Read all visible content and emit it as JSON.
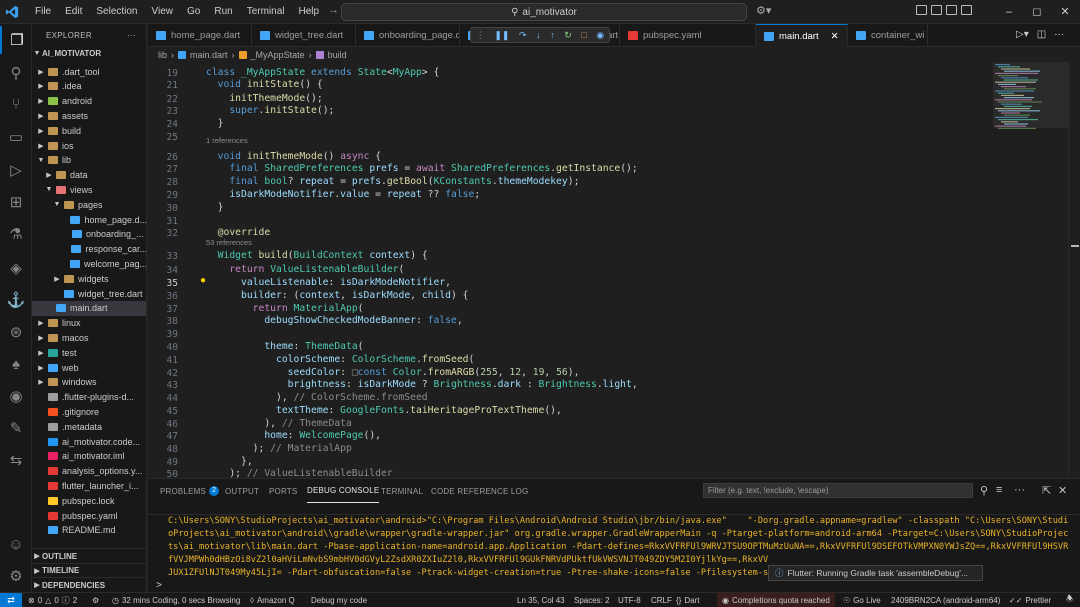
{
  "titlebar": {
    "menu": [
      "File",
      "Edit",
      "Selection",
      "View",
      "Go",
      "Run",
      "Terminal",
      "Help"
    ],
    "search_text": "ai_motivator",
    "window_controls": [
      "–",
      "◻",
      "✕"
    ]
  },
  "activity_bar": {
    "icons": [
      "explorer-icon",
      "search-icon",
      "source-control-icon",
      "remote-explorer-icon",
      "run-debug-icon",
      "extensions-icon",
      "testing-icon",
      "flutter-icon",
      "docker-icon",
      "gitlens-icon",
      "mongodb-icon",
      "github-icon",
      "edit-icon",
      "live-share-icon",
      "accounts-icon",
      "settings-icon"
    ]
  },
  "explorer": {
    "title": "EXPLORER",
    "more": "···",
    "root": "AI_MOTIVATOR",
    "items": [
      {
        "label": ".dart_tool",
        "type": "folder",
        "depth": 1,
        "open": false
      },
      {
        "label": ".idea",
        "type": "folder",
        "depth": 1,
        "open": false
      },
      {
        "label": "android",
        "type": "folder-android",
        "depth": 1,
        "open": false
      },
      {
        "label": "assets",
        "type": "folder",
        "depth": 1,
        "open": false
      },
      {
        "label": "build",
        "type": "folder",
        "depth": 1,
        "open": false
      },
      {
        "label": "ios",
        "type": "folder",
        "depth": 1,
        "open": false
      },
      {
        "label": "lib",
        "type": "folder",
        "depth": 1,
        "open": true
      },
      {
        "label": "data",
        "type": "folder",
        "depth": 2,
        "open": false
      },
      {
        "label": "views",
        "type": "folder-views",
        "depth": 2,
        "open": true
      },
      {
        "label": "pages",
        "type": "folder",
        "depth": 3,
        "open": true
      },
      {
        "label": "home_page.d...",
        "type": "dart",
        "depth": 4
      },
      {
        "label": "onboarding_...",
        "type": "dart",
        "depth": 4
      },
      {
        "label": "response_car...",
        "type": "dart",
        "depth": 4
      },
      {
        "label": "welcome_pag...",
        "type": "dart",
        "depth": 4
      },
      {
        "label": "widgets",
        "type": "folder",
        "depth": 3,
        "open": false
      },
      {
        "label": "widget_tree.dart",
        "type": "dart",
        "depth": 3
      },
      {
        "label": "main.dart",
        "type": "dart",
        "depth": 2,
        "selected": true
      },
      {
        "label": "linux",
        "type": "folder",
        "depth": 1,
        "open": false
      },
      {
        "label": "macos",
        "type": "folder",
        "depth": 1,
        "open": false
      },
      {
        "label": "test",
        "type": "folder-test",
        "depth": 1,
        "open": false
      },
      {
        "label": "web",
        "type": "folder-web",
        "depth": 1,
        "open": false
      },
      {
        "label": "windows",
        "type": "folder",
        "depth": 1,
        "open": false
      },
      {
        "label": ".flutter-plugins-d...",
        "type": "file",
        "depth": 1
      },
      {
        "label": ".gitignore",
        "type": "git",
        "depth": 1
      },
      {
        "label": ".metadata",
        "type": "file",
        "depth": 1
      },
      {
        "label": "ai_motivator.code...",
        "type": "vscode",
        "depth": 1
      },
      {
        "label": "ai_motivator.iml",
        "type": "iml",
        "depth": 1
      },
      {
        "label": "analysis_options.y...",
        "type": "yaml",
        "depth": 1
      },
      {
        "label": "flutter_launcher_i...",
        "type": "yaml",
        "depth": 1
      },
      {
        "label": "pubspec.lock",
        "type": "lock",
        "depth": 1
      },
      {
        "label": "pubspec.yaml",
        "type": "yaml",
        "depth": 1
      },
      {
        "label": "README.md",
        "type": "md",
        "depth": 1
      }
    ],
    "sections": [
      "OUTLINE",
      "TIMELINE",
      "DEPENDENCIES"
    ]
  },
  "tabs": [
    {
      "label": "home_page.dart",
      "active": false
    },
    {
      "label": "widget_tree.dart",
      "active": false
    },
    {
      "label": "onboarding_page.dart",
      "active": false
    },
    {
      "label": "navbar_actionmode_widget.dart",
      "active": false
    },
    {
      "label": "pubspec.yaml",
      "active": false
    },
    {
      "label": "main.dart",
      "active": true
    },
    {
      "label": "container_wi",
      "active": false
    }
  ],
  "breadcrumb": [
    "lib",
    "main.dart",
    "_MyAppState",
    "build"
  ],
  "code_lines": [
    {
      "n": "19",
      "html": "<span class='k'>class</span> <span class='t'>_MyAppState</span> <span class='k'>extends</span> <span class='t'>State</span>&lt;<span class='t'>MyApp</span>&gt; {"
    },
    {
      "n": "21",
      "html": "  <span class='k'>void</span> <span class='f'>initState</span>() {"
    },
    {
      "n": "22",
      "html": "    <span class='f'>initThemeMode</span>();"
    },
    {
      "n": "23",
      "html": "    <span class='k'>super</span>.<span class='f'>initState</span>();"
    },
    {
      "n": "24",
      "html": "  }"
    },
    {
      "n": "25",
      "html": ""
    },
    {
      "n": "26",
      "html": "  <span class='k'>void</span> <span class='f'>initThemeMode</span>() <span class='kc'>async</span> {"
    },
    {
      "n": "27",
      "html": "    <span class='k'>final</span> <span class='t'>SharedPreferences</span> <span class='v'>prefs</span> = <span class='kc'>await</span> <span class='t'>SharedPreferences</span>.<span class='f'>getInstance</span>();"
    },
    {
      "n": "28",
      "html": "    <span class='k'>final</span> <span class='t'>bool</span>? <span class='v'>repeat</span> = <span class='v'>prefs</span>.<span class='f'>getBool</span>(<span class='t'>KConstants</span>.<span class='v'>themeModekey</span>);"
    },
    {
      "n": "29",
      "html": "    <span class='v'>isDarkModeNotifier</span>.<span class='v'>value</span> = <span class='v'>repeat</span> ?? <span class='k'>false</span>;"
    },
    {
      "n": "30",
      "html": "  }"
    },
    {
      "n": "31",
      "html": ""
    },
    {
      "n": "32",
      "html": "  <span class='f'>@override</span>"
    },
    {
      "n": "33",
      "html": "  <span class='t'>Widget</span> <span class='f'>build</span>(<span class='t'>BuildContext</span> <span class='v'>context</span>) {"
    },
    {
      "n": "34",
      "html": "    <span class='kc'>return</span> <span class='t'>ValueListenableBuilder</span>("
    },
    {
      "n": "35",
      "html": "      <span class='v'>valueListenable</span>: <span class='v'>isDarkModeNotifier</span>,"
    },
    {
      "n": "36",
      "html": "      <span class='v'>builder</span>: (<span class='v'>context</span>, <span class='v'>isDarkMode</span>, <span class='v'>child</span>) {"
    },
    {
      "n": "37",
      "html": "        <span class='kc'>return</span> <span class='t'>MaterialApp</span>("
    },
    {
      "n": "38",
      "html": "          <span class='v'>debugShowCheckedModeBanner</span>: <span class='k'>false</span>,"
    },
    {
      "n": "39",
      "html": ""
    },
    {
      "n": "40",
      "html": "          <span class='v'>theme</span>: <span class='t'>ThemeData</span>("
    },
    {
      "n": "41",
      "html": "            <span class='v'>colorScheme</span>: <span class='t'>ColorScheme</span>.<span class='f'>fromSeed</span>("
    },
    {
      "n": "42",
      "html": "              <span class='v'>seedColor</span>: <span class='g'>&#9633;</span><span class='k'>const</span> <span class='t'>Color</span>.<span class='f'>fromARGB</span>(<span class='n'>255</span>, <span class='n'>12</span>, <span class='n'>19</span>, <span class='n'>56</span>),"
    },
    {
      "n": "43",
      "html": "              <span class='v'>brightness</span>: <span class='v'>isDarkMode</span> ? <span class='t'>Brightness</span>.<span class='v'>dark</span> : <span class='t'>Brightness</span>.<span class='v'>light</span>,"
    },
    {
      "n": "44",
      "html": "            ), <span class='g'>// ColorScheme.fromSeed</span>"
    },
    {
      "n": "45",
      "html": "            <span class='v'>textTheme</span>: <span class='t'>GoogleFonts</span>.<span class='f'>taiHeritageProTextTheme</span>(),"
    },
    {
      "n": "46",
      "html": "          ), <span class='g'>// ThemeData</span>"
    },
    {
      "n": "47",
      "html": "          <span class='v'>home</span>: <span class='t'>WelcomePage</span>(),"
    },
    {
      "n": "48",
      "html": "        ); <span class='g'>// MaterialApp</span>"
    },
    {
      "n": "49",
      "html": "      },"
    },
    {
      "n": "50",
      "html": "    ); <span class='g'>// ValueListenableBuilder</span>"
    }
  ],
  "code_refs": {
    "r26": "1 references",
    "r33": "53 references"
  },
  "panel": {
    "tabs": [
      "PROBLEMS",
      "OUTPUT",
      "PORTS",
      "DEBUG CONSOLE",
      "TERMINAL",
      "CODE REFERENCE LOG"
    ],
    "problems_count": "2",
    "filter_placeholder": "Filter (e.g. text, !exclude, \\escape)",
    "console_lines": [
      "C:\\Users\\SONY\\StudioProjects\\ai_motivator\\android>\"C:\\Program Files\\Android\\Android Studio\\jbr/bin/java.exe\"    \"-Dorg.gradle.appname=gradlew\" -classpath \"C:\\Users\\SONY\\Studi",
      "oProjects\\ai_motivator\\android\\\\gradle\\wrapper\\gradle-wrapper.jar\" org.gradle.wrapper.GradleWrapperMain -q -Ptarget-platform=android-arm64 -Ptarget=C:\\Users\\SONY\\StudioProjec",
      "ts\\ai_motivator\\lib\\main.dart -Pbase-application-name=android.app.Application -Pdart-defines=RkxVVFRFUl9WRVJTSU9OPTMuMzUuNA==,RkxVVFRFUl9DSEFOTkVMPXN0YWJsZQ==,RkxVVFRFUl9HSVR",
      "fVVJMPWh0dHBzOi8vZ2l0aHViLmNvbS9mbHV0dGVyL2ZsdXR0ZXIuZ2l0,RkxVVFRFUl9GUkFNRVdPUktfUkVWSVNJT049ZDY5M2I0YjlkYg==,RkxVV",
      "JUX1ZFUlNJT049My45LjI= -Pdart-obfuscation=false -Ptrack-widget-creation=true -Ptree-shake-icons=false -Pfilesystem-s"
    ],
    "toast": "Flutter: Running Gradle task 'assembleDebug'...",
    "prompt": ">"
  },
  "statusbar": {
    "remote": "⇄",
    "errors": "0",
    "warnings": "0",
    "info": "2",
    "coding_time": "32 mins Coding, 0 secs Browsing",
    "amazon_q": "Amazon Q",
    "debug": "Debug my code",
    "position": "Ln 35, Col 43",
    "spaces": "Spaces: 2",
    "encoding": "UTF-8",
    "eol": "CRLF",
    "language": "Dart",
    "quota": "Completions quota reached",
    "golive": "Go Live",
    "device": "2409BRN2CA (android-arm64)",
    "prettier": "Prettier"
  },
  "colors": {
    "accent": "#0078d4",
    "background": "#1f1f1f",
    "console_text": "#e9b32a"
  }
}
